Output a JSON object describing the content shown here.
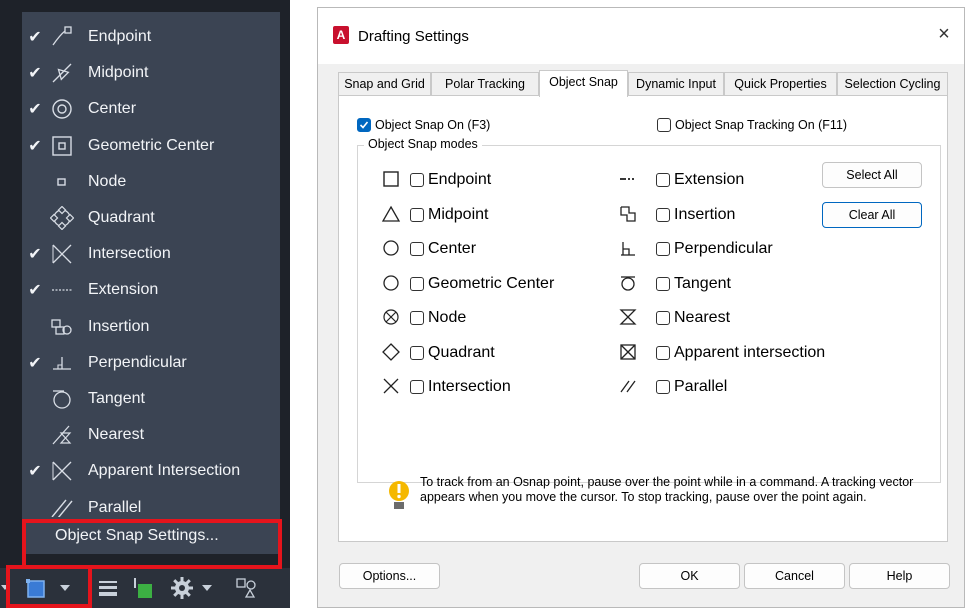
{
  "snap_menu": {
    "items": [
      {
        "label": "Endpoint",
        "checked": true,
        "icon": "endpoint-icon"
      },
      {
        "label": "Midpoint",
        "checked": true,
        "icon": "midpoint-icon"
      },
      {
        "label": "Center",
        "checked": true,
        "icon": "center-icon"
      },
      {
        "label": "Geometric Center",
        "checked": true,
        "icon": "geometric-center-icon"
      },
      {
        "label": "Node",
        "checked": false,
        "icon": "node-icon"
      },
      {
        "label": "Quadrant",
        "checked": false,
        "icon": "quadrant-icon"
      },
      {
        "label": "Intersection",
        "checked": true,
        "icon": "intersection-icon"
      },
      {
        "label": "Extension",
        "checked": true,
        "icon": "extension-icon"
      },
      {
        "label": "Insertion",
        "checked": false,
        "icon": "insertion-icon"
      },
      {
        "label": "Perpendicular",
        "checked": true,
        "icon": "perpendicular-icon"
      },
      {
        "label": "Tangent",
        "checked": false,
        "icon": "tangent-icon"
      },
      {
        "label": "Nearest",
        "checked": false,
        "icon": "nearest-icon"
      },
      {
        "label": "Apparent Intersection",
        "checked": true,
        "icon": "apparent-intersection-icon"
      },
      {
        "label": "Parallel",
        "checked": false,
        "icon": "parallel-icon"
      }
    ],
    "settings_label": "Object Snap Settings...",
    "check_glyph": "✔"
  },
  "dialog": {
    "title": "Drafting Settings",
    "app_icon_letter": "A",
    "close_glyph": "×",
    "tabs": [
      "Snap and Grid",
      "Polar Tracking",
      "Object Snap",
      "Dynamic Input",
      "Quick Properties",
      "Selection Cycling"
    ],
    "active_tab": "Object Snap",
    "snap_on_label": "Object Snap On (F3)",
    "snap_on_checked": true,
    "tracking_on_label": "Object Snap Tracking On (F11)",
    "tracking_on_checked": false,
    "modes_title": "Object Snap modes",
    "modes_left": [
      "Endpoint",
      "Midpoint",
      "Center",
      "Geometric Center",
      "Node",
      "Quadrant",
      "Intersection"
    ],
    "modes_right": [
      "Extension",
      "Insertion",
      "Perpendicular",
      "Tangent",
      "Nearest",
      "Apparent intersection",
      "Parallel"
    ],
    "select_all_label": "Select All",
    "clear_all_label": "Clear All",
    "info_text": "To track from an Osnap point, pause over the point while in a command.  A tracking vector appears when you move the cursor.  To stop tracking, pause over the point again.",
    "buttons": {
      "options": "Options...",
      "ok": "OK",
      "cancel": "Cancel",
      "help": "Help"
    }
  },
  "colors": {
    "accent": "#0067c0",
    "highlight": "#e5141c",
    "menu_bg": "#3b4453",
    "panel_bg": "#1e2229"
  }
}
